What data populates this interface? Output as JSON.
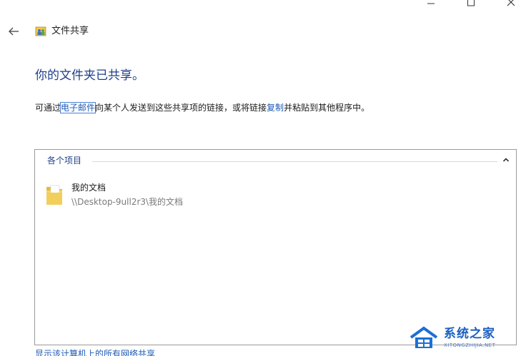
{
  "window": {
    "icons": {
      "minimize": "minimize-icon",
      "maximize": "maximize-icon",
      "close": "close-icon"
    }
  },
  "nav": {
    "back_icon": "back-arrow-icon",
    "app_icon": "file-sharing-icon",
    "title": "文件共享"
  },
  "main": {
    "heading": "你的文件夹已共享。",
    "desc_prefix": "可通过",
    "desc_email_link": "电子邮件",
    "desc_middle": "向某个人发送到这些共享项的链接，或将链接",
    "desc_copy_link": "复制",
    "desc_suffix": "并粘贴到其他程序中。"
  },
  "panel": {
    "group_label": "各个项目",
    "collapse_icon": "chevron-up-icon",
    "items": [
      {
        "name": "我的文档",
        "path": "\\\\Desktop-9ull2r3\\我的文档",
        "icon": "folder-icon"
      }
    ]
  },
  "footer": {
    "show_all_link": "显示该计算机上的所有网络共享"
  },
  "watermark": {
    "text": "系统之家",
    "sub": "XITONGZHIJIA.NET"
  },
  "colors": {
    "heading": "#1f3f8a",
    "link": "#1d5bb5",
    "panel_border": "#9a9a9a",
    "folder": "#f2cf5b"
  }
}
